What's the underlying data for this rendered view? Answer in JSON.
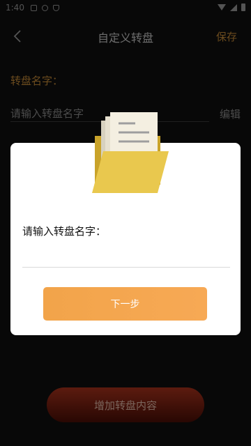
{
  "status_bar": {
    "time": "1:40",
    "icons": [
      "notification-icon",
      "gear-icon",
      "shield-icon",
      "wifi-icon",
      "signal-icon",
      "battery-icon"
    ]
  },
  "nav": {
    "title": "自定义转盘",
    "save_label": "保存",
    "back_icon": "chevron-left-icon"
  },
  "form": {
    "name_label": "转盘名字：",
    "name_placeholder": "请输入转盘名字",
    "name_value": "",
    "edit_label": "编辑"
  },
  "bottom": {
    "add_button_label": "增加转盘内容"
  },
  "dialog": {
    "illustration": "folder-icon",
    "label": "请输入转盘名字：",
    "input_value": "",
    "next_label": "下一步"
  },
  "colors": {
    "accent": "#c58a38",
    "next_button": "#f6a74f",
    "add_button_top": "#a8321c",
    "add_button_bottom": "#4a0e06",
    "background": "#0f0f0f"
  }
}
